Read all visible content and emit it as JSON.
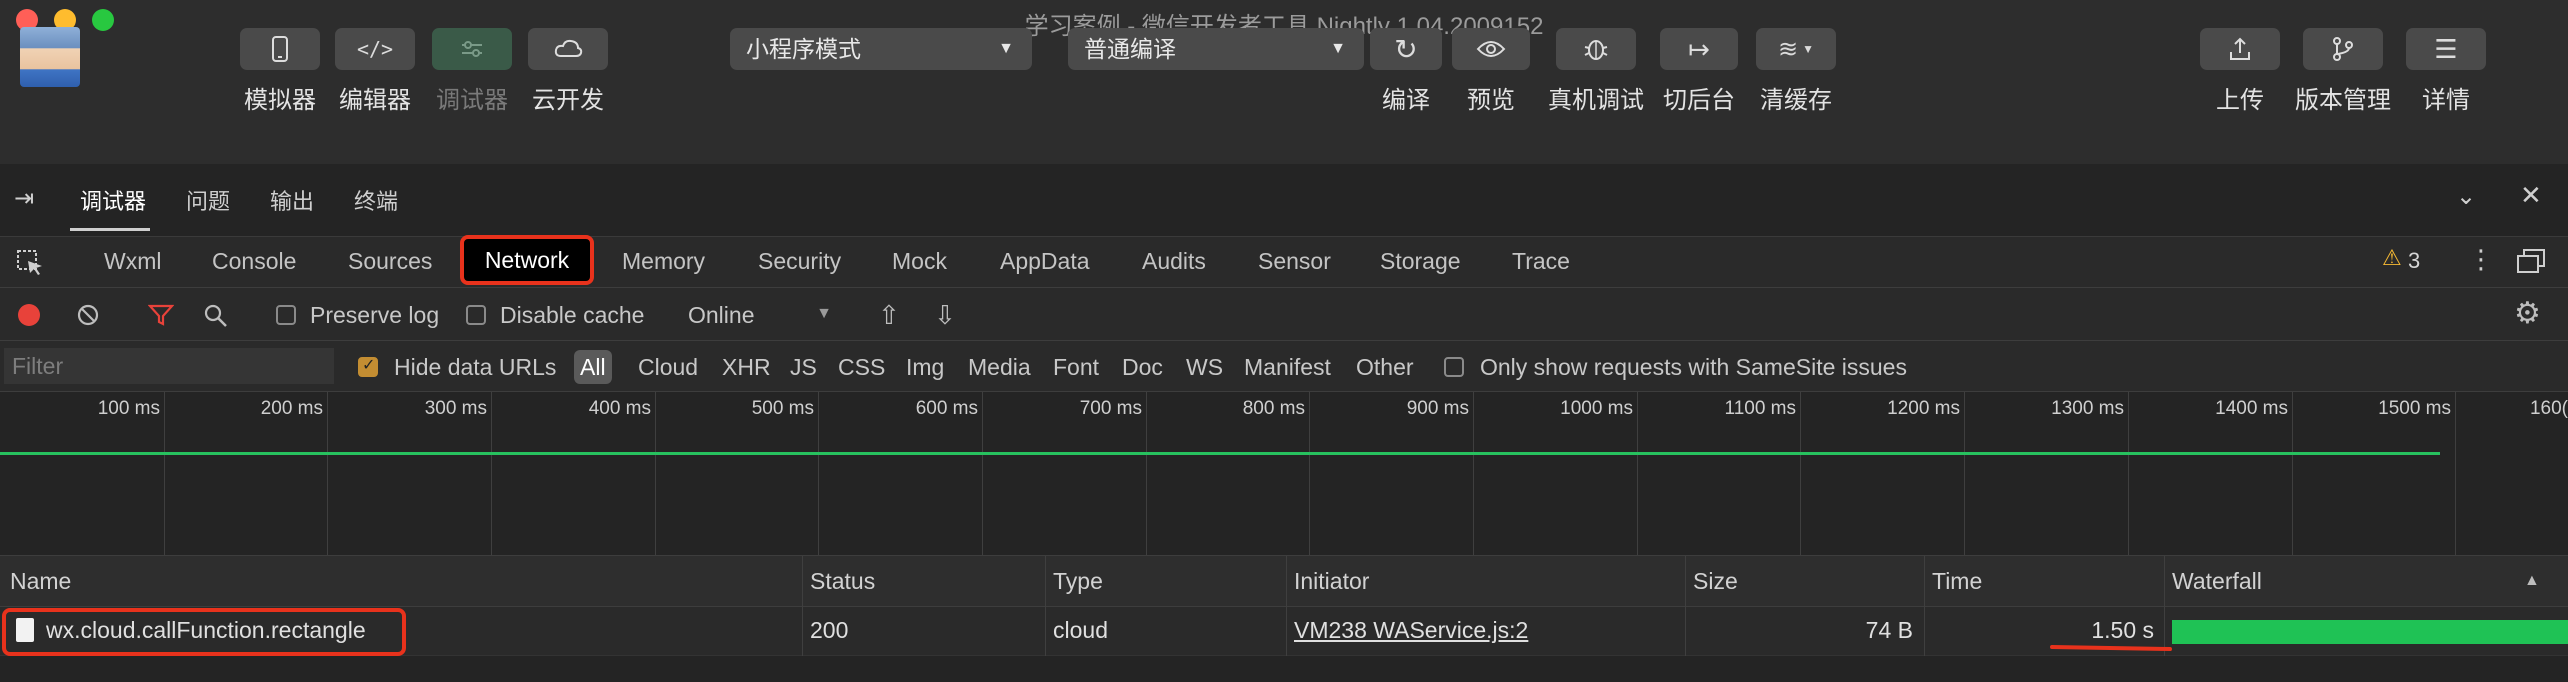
{
  "window": {
    "title": "学习案例 - 微信开发者工具 Nightly 1.04.2009152"
  },
  "toolbar": {
    "simulator": "模拟器",
    "editor": "编辑器",
    "debugger": "调试器",
    "cloud": "云开发",
    "mode_select": "小程序模式",
    "compile_select": "普通编译",
    "compile": "编译",
    "preview": "预览",
    "real_debug": "真机调试",
    "background": "切后台",
    "clear_cache": "清缓存",
    "upload": "上传",
    "version": "版本管理",
    "details": "详情"
  },
  "devtools_tabs": [
    "调试器",
    "问题",
    "输出",
    "终端"
  ],
  "panel_tabs": [
    "Wxml",
    "Console",
    "Sources",
    "Network",
    "Memory",
    "Security",
    "Mock",
    "AppData",
    "Audits",
    "Sensor",
    "Storage",
    "Trace"
  ],
  "warning_count": "3",
  "network_toolbar": {
    "preserve_log": "Preserve log",
    "disable_cache": "Disable cache",
    "throttle": "Online"
  },
  "filter": {
    "placeholder": "Filter",
    "hide_data_urls": "Hide data URLs",
    "types": [
      "All",
      "Cloud",
      "XHR",
      "JS",
      "CSS",
      "Img",
      "Media",
      "Font",
      "Doc",
      "WS",
      "Manifest",
      "Other"
    ],
    "samesite": "Only show requests with SameSite issues"
  },
  "timeline": {
    "ticks": [
      "100 ms",
      "200 ms",
      "300 ms",
      "400 ms",
      "500 ms",
      "600 ms",
      "700 ms",
      "800 ms",
      "900 ms",
      "1000 ms",
      "1100 ms",
      "1200 ms",
      "1300 ms",
      "1400 ms",
      "1500 ms",
      "160("
    ]
  },
  "table": {
    "columns": [
      "Name",
      "Status",
      "Type",
      "Initiator",
      "Size",
      "Time",
      "Waterfall"
    ],
    "rows": [
      {
        "name": "wx.cloud.callFunction.rectangle",
        "status": "200",
        "type": "cloud",
        "initiator": "VM238 WAService.js:2",
        "size": "74 B",
        "time": "1.50 s"
      }
    ]
  },
  "colors": {
    "accent_red": "#e8321c",
    "waterfall_green": "#1fc255",
    "checkbox_checked": "#c38d32"
  }
}
